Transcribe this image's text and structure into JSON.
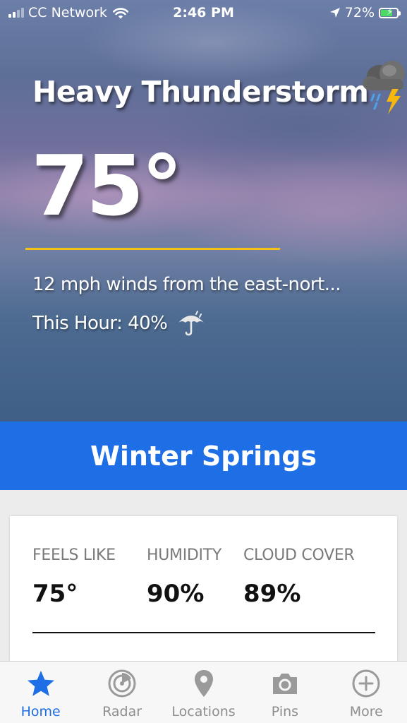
{
  "status_bar": {
    "carrier": "CC Network",
    "time": "2:46 PM",
    "battery_percent": "72%",
    "battery_level": 0.72,
    "icons": [
      "signal-icon",
      "wifi-icon",
      "location-arrow-icon",
      "battery-charging-icon"
    ]
  },
  "weather": {
    "condition": "Heavy Thunderstorm",
    "condition_icon": "thunderstorm-icon",
    "temperature": "75°",
    "wind": "12 mph winds from the east-nort...",
    "precip": "This Hour: 40%",
    "precip_icon": "umbrella-rain-icon"
  },
  "location": {
    "name": "Winter Springs"
  },
  "stats": [
    {
      "label": "FEELS LIKE",
      "value": "75°"
    },
    {
      "label": "HUMIDITY",
      "value": "90%"
    },
    {
      "label": "CLOUD COVER",
      "value": "89%"
    }
  ],
  "tabbar": {
    "active": "Home",
    "tabs": [
      {
        "label": "Home",
        "icon": "star-icon"
      },
      {
        "label": "Radar",
        "icon": "radar-icon"
      },
      {
        "label": "Locations",
        "icon": "map-pin-icon"
      },
      {
        "label": "Pins",
        "icon": "camera-icon"
      },
      {
        "label": "More",
        "icon": "plus-circle-icon"
      }
    ]
  },
  "colors": {
    "accent_blue": "#1e6ee6",
    "divider_yellow": "#f2c316",
    "battery_green": "#4cd964"
  }
}
